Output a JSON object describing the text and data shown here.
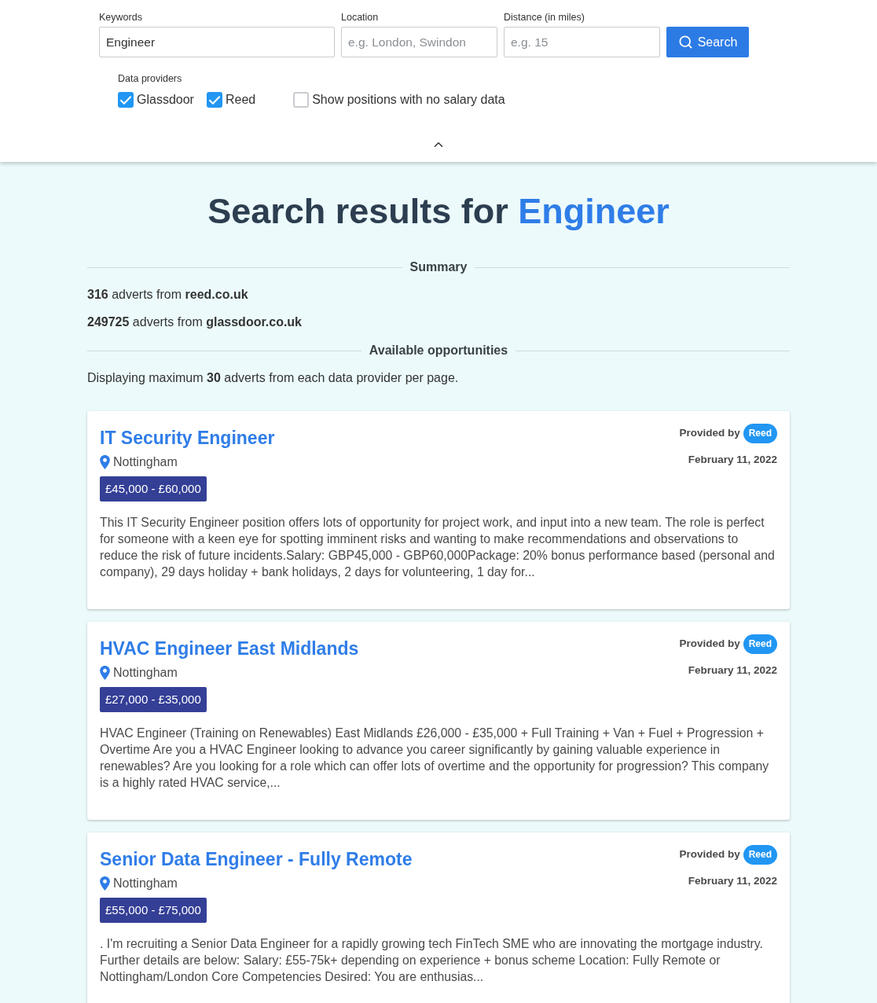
{
  "search_form": {
    "fields": [
      {
        "label": "Keywords",
        "value": "Engineer"
      },
      {
        "label": "Location",
        "placeholder": "e.g. London, Swindon"
      },
      {
        "label": "Distance (in miles)",
        "placeholder": "e.g. 15"
      }
    ],
    "search_button": "Search",
    "providers_label": "Data providers",
    "providers": [
      {
        "label": "Glassdoor",
        "checked": true
      },
      {
        "label": "Reed",
        "checked": true
      }
    ],
    "no_salary_option": {
      "label": "Show positions with no salary data",
      "checked": false
    }
  },
  "results": {
    "heading": {
      "text": "Search results for",
      "keyword": "Engineer"
    },
    "summary_title": "Summary",
    "summary_lines": [
      "**316** adverts from **reed.co.uk**",
      "**249725** adverts from **glassdoor.co.uk**"
    ],
    "opportunities_title": "Available opportunities",
    "display_note": "Displaying maximum **30** adverts from each data provider per page.",
    "jobs": [
      {
        "title": "IT Security Engineer",
        "location": "Nottingham",
        "salary": "£45,000 - £60,000",
        "description": "This IT Security Engineer position offers lots of opportunity for project work, and input into a new team. The role is perfect for someone with a keen eye for spotting imminent risks and wanting to make recommendations and observations to reduce the risk of future incidents.Salary: GBP45,000 - GBP60,000Package: 20% bonus performance based (personal and company), 29 days holiday + bank holidays, 2 days for volunteering, 1 day for...",
        "provided_by_label": "Provided by",
        "provider": "Reed",
        "date": "February 11, 2022"
      },
      {
        "title": "HVAC Engineer East Midlands",
        "location": "Nottingham",
        "salary": "£27,000 - £35,000",
        "description": "HVAC Engineer (Training on Renewables) East Midlands £26,000 - £35,000 + Full Training + Van + Fuel + Progression + Overtime Are you a HVAC Engineer looking to advance you career significantly by gaining valuable experience in renewables? Are you looking for a role which can offer lots of overtime and the opportunity for progression? This company is a highly rated HVAC service,...",
        "provided_by_label": "Provided by",
        "provider": "Reed",
        "date": "February 11, 2022"
      },
      {
        "title": "Senior Data Engineer - Fully Remote",
        "location": "Nottingham",
        "salary": "£55,000 - £75,000",
        "description": ". I'm recruiting a Senior Data Engineer for a rapidly growing tech FinTech SME who are innovating the mortgage industry. Further details are below: Salary: £55-75k+ depending on experience + bonus scheme Location: Fully Remote or Nottingham/London Core Competencies Desired: You are enthusias...",
        "provided_by_label": "Provided by",
        "provider": "Reed",
        "date": "February 11, 2022"
      }
    ]
  }
}
